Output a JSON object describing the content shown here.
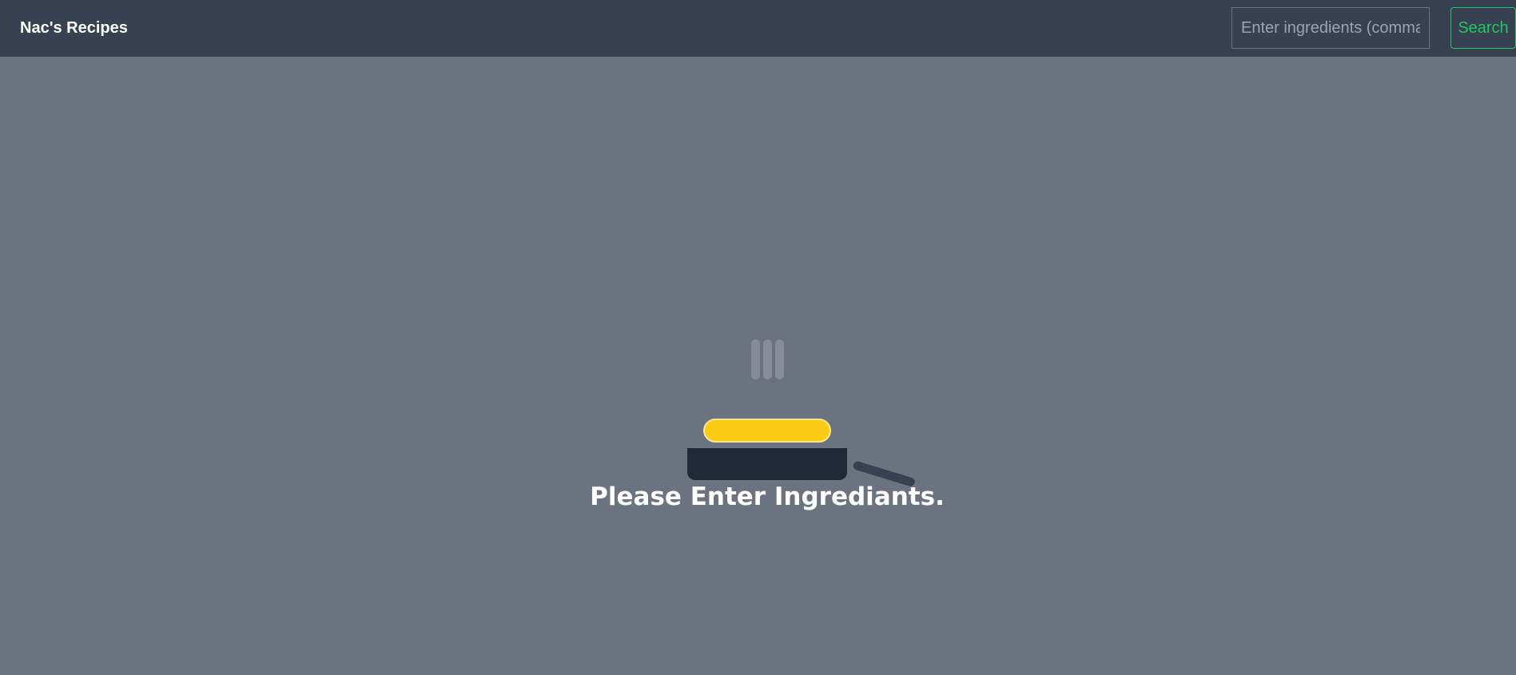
{
  "navbar": {
    "brand": "Nac's Recipes",
    "search": {
      "placeholder": "Enter ingredients (comma separated)",
      "value": "",
      "button_label": "Search"
    }
  },
  "main": {
    "message": "Please Enter Ingrediants."
  },
  "icons": {
    "loader": [
      "steam-icon",
      "food-icon",
      "frying-pan-icon"
    ]
  },
  "colors": {
    "navbar_bg": "#374151",
    "page_bg": "#6b7280",
    "accent_green": "#22c55e",
    "food_yellow": "#facc15",
    "pan_dark": "#1f2937"
  }
}
